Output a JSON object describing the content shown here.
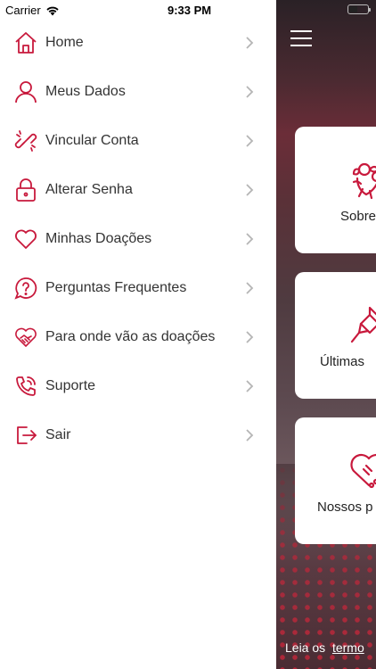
{
  "status_bar": {
    "carrier": "Carrier",
    "time": "9:33 PM"
  },
  "colors": {
    "accent": "#c8193c",
    "text": "#333333",
    "chevron": "#b5b5b5"
  },
  "menu": {
    "items": [
      {
        "label": "Home",
        "icon": "home-icon"
      },
      {
        "label": "Meus Dados",
        "icon": "user-icon"
      },
      {
        "label": "Vincular Conta",
        "icon": "link-icon"
      },
      {
        "label": "Alterar Senha",
        "icon": "lock-icon"
      },
      {
        "label": "Minhas Doações",
        "icon": "heart-icon"
      },
      {
        "label": "Perguntas Frequentes",
        "icon": "question-bubble-icon"
      },
      {
        "label": "Para onde vão as doações",
        "icon": "heart-handshake-icon"
      },
      {
        "label": "Suporte",
        "icon": "phone-icon"
      },
      {
        "label": "Sair",
        "icon": "logout-icon"
      }
    ]
  },
  "main": {
    "cards": [
      {
        "label": "Sobre",
        "icon": "flowers-icon"
      },
      {
        "label": "Últimas",
        "icon": "pin-icon"
      },
      {
        "label": "Nossos p",
        "icon": "heart-puzzle-icon"
      }
    ],
    "footer": {
      "prefix": "Leia os",
      "link": "termo"
    }
  }
}
